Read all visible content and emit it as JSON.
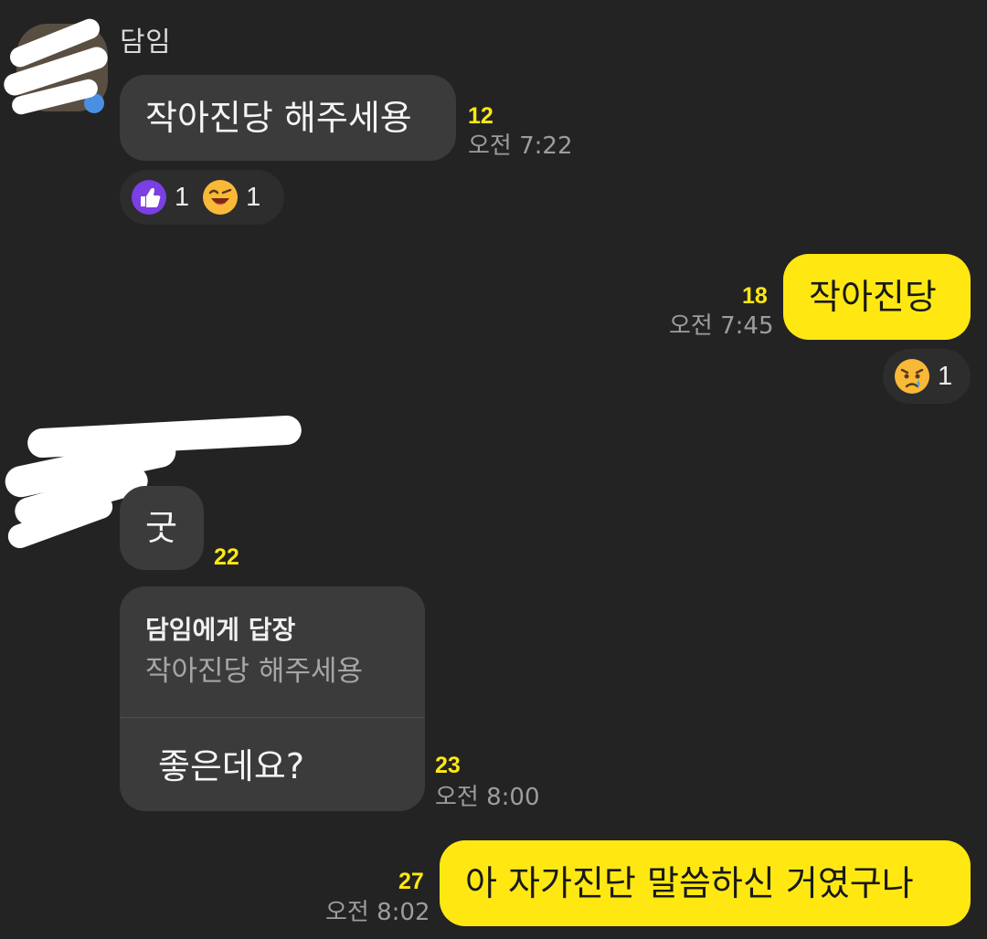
{
  "messages": [
    {
      "sender": "담임",
      "text": "작아진당 해주세용",
      "unread": "12",
      "time": "오전 7:22",
      "reactions": [
        {
          "icon": "thumbs-up-icon",
          "count": "1"
        },
        {
          "icon": "laughing-face-icon",
          "count": "1"
        }
      ]
    },
    {
      "text": "작아진당",
      "unread": "18",
      "time": "오전 7:45",
      "reactions": [
        {
          "icon": "sad-tear-face-icon",
          "count": "1"
        }
      ]
    },
    {
      "text": "굿",
      "unread": "22"
    },
    {
      "reply_title": "담임에게 답장",
      "reply_quote": "작아진당 해주세용",
      "text": "좋은데요?",
      "unread": "23",
      "time": "오전 8:00"
    },
    {
      "text": "아 자가진단 말씀하신 거였구나",
      "unread": "27",
      "time": "오전 8:02"
    }
  ],
  "colors": {
    "background": "#232323",
    "incoming_bubble": "#3b3b3b",
    "outgoing_bubble": "#ffe812",
    "unread_count": "#ffe812",
    "timestamp": "#9d9d9d"
  }
}
